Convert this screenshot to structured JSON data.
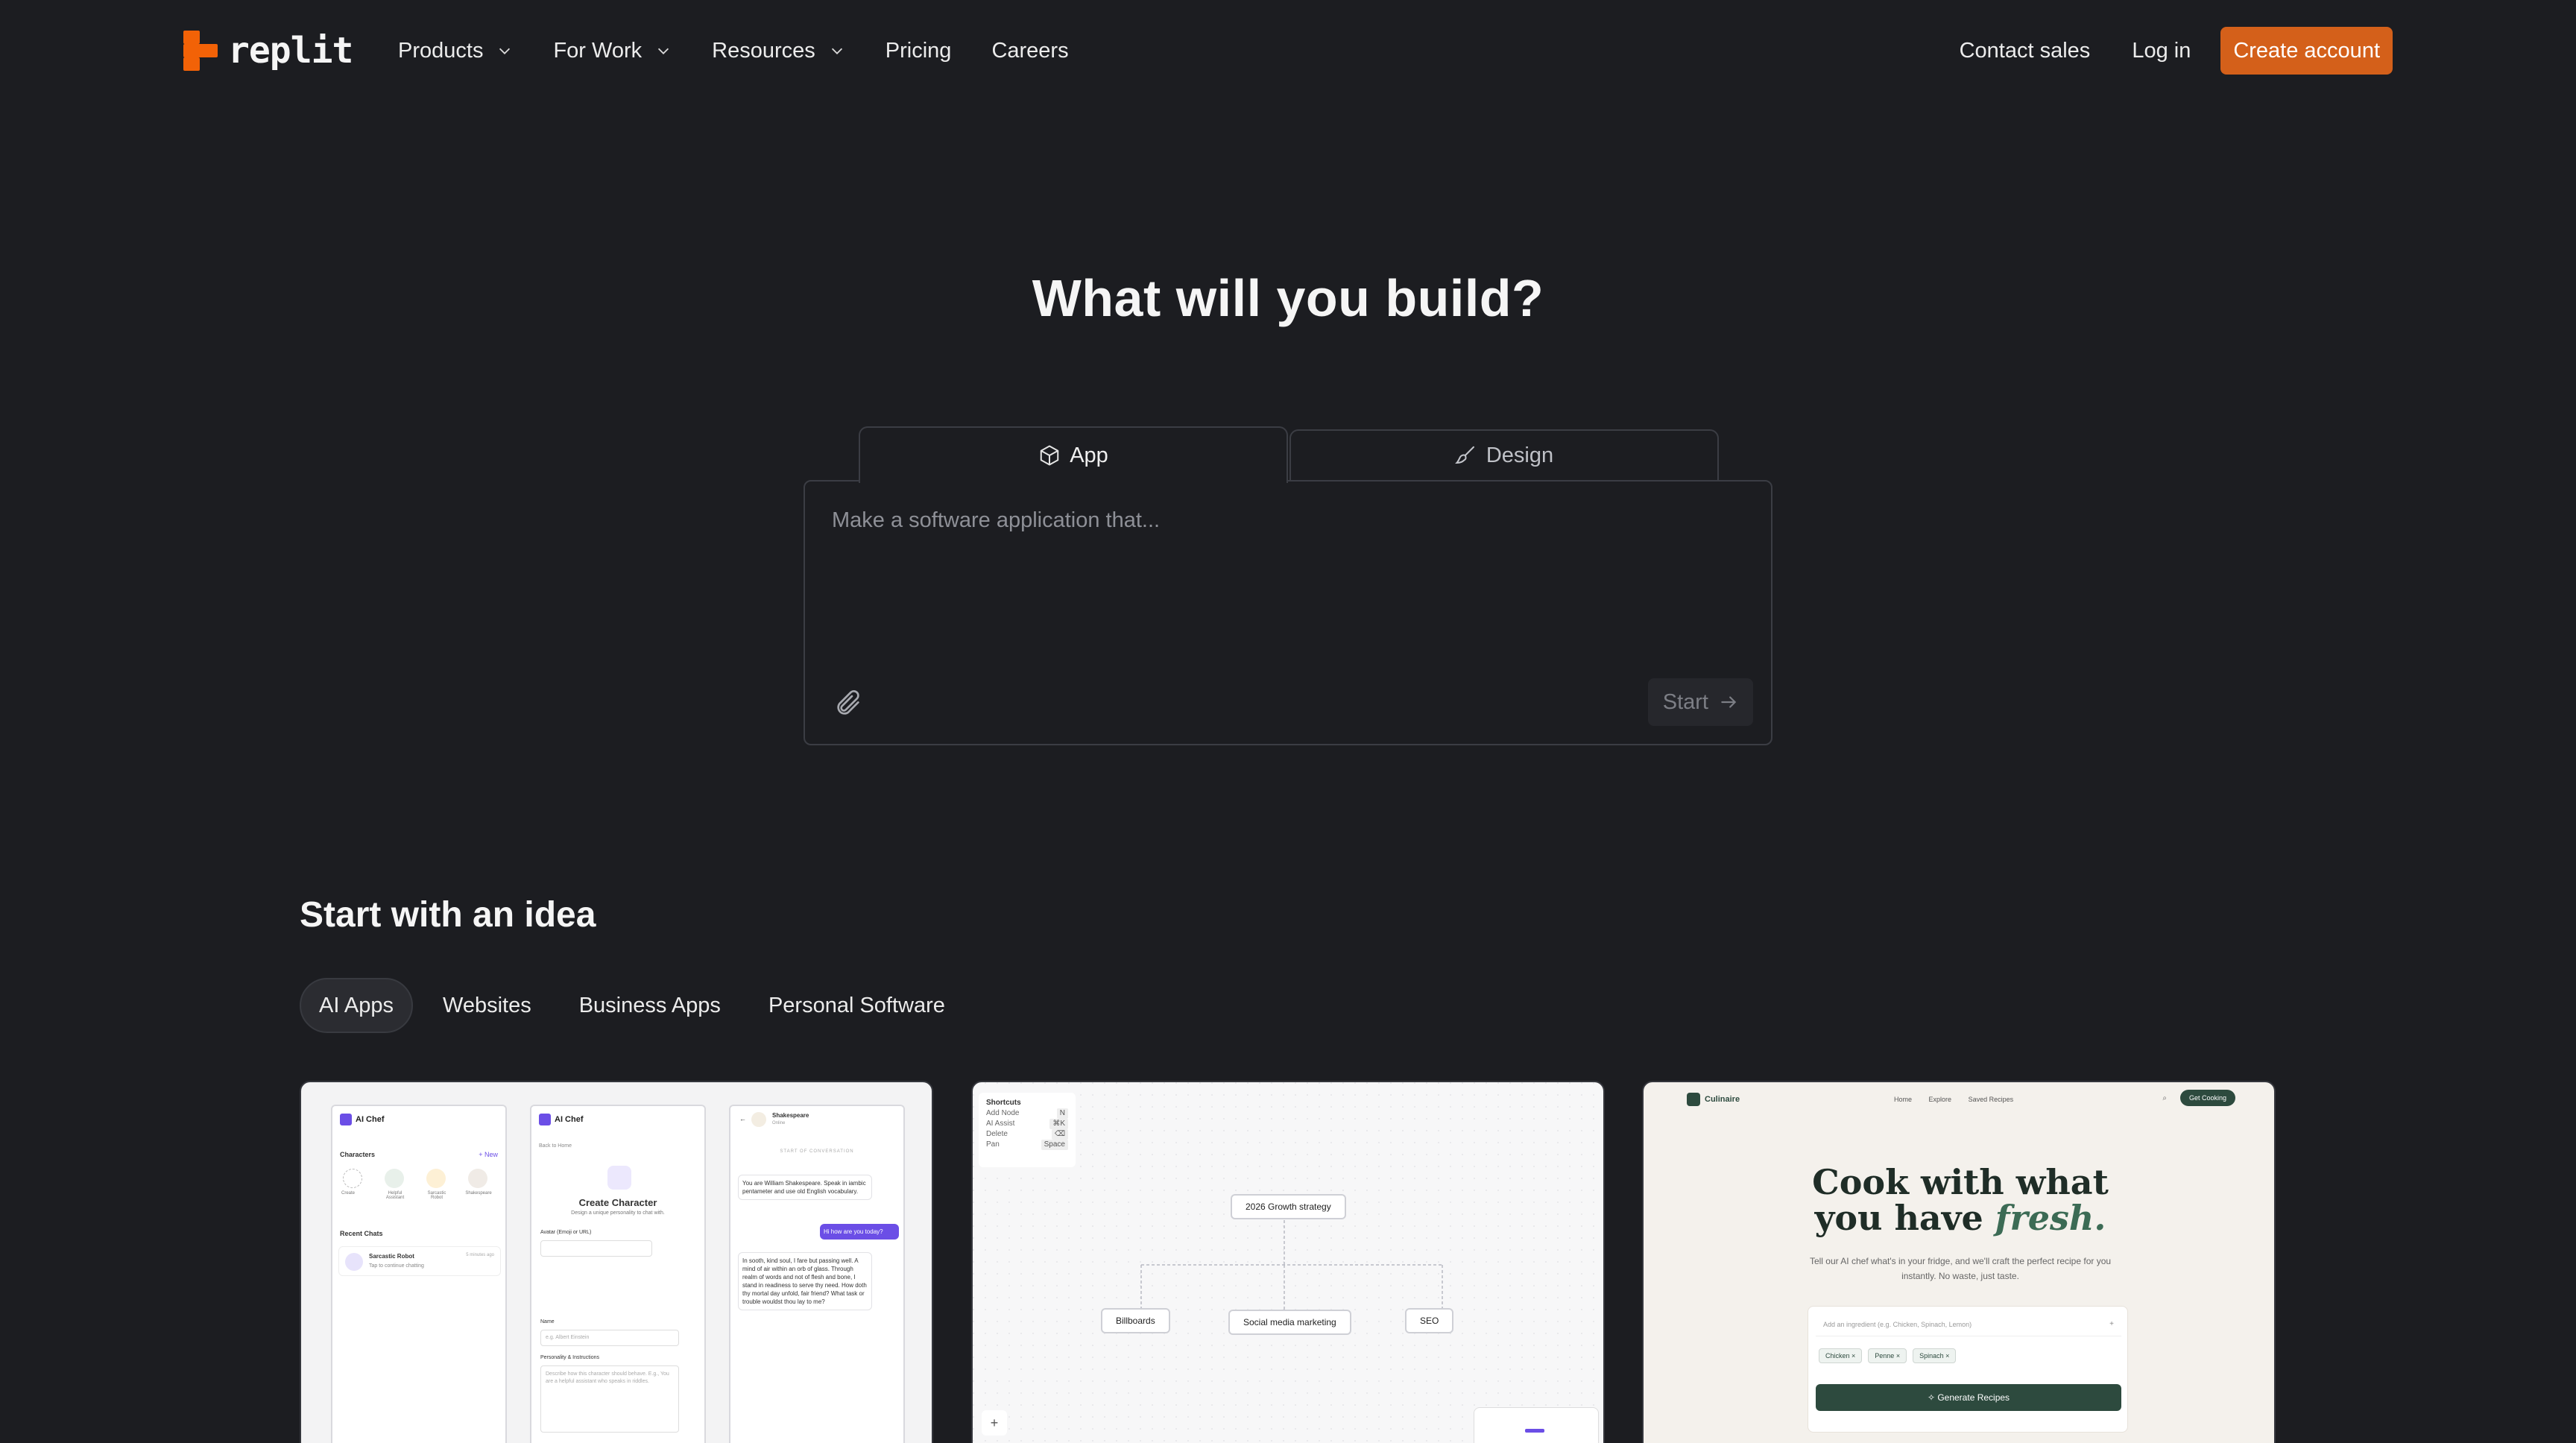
{
  "brand": {
    "name": "replit",
    "accent": "#f26207"
  },
  "nav": {
    "menu": [
      {
        "label": "Products",
        "has_dropdown": true
      },
      {
        "label": "For Work",
        "has_dropdown": true
      },
      {
        "label": "Resources",
        "has_dropdown": true
      },
      {
        "label": "Pricing",
        "has_dropdown": false
      },
      {
        "label": "Careers",
        "has_dropdown": false
      }
    ],
    "contact_sales": "Contact sales",
    "login": "Log in",
    "create_account": "Create account"
  },
  "hero": {
    "title": "What will you build?",
    "tabs": [
      {
        "label": "App",
        "icon": "cube-icon",
        "active": true
      },
      {
        "label": "Design",
        "icon": "brush-icon",
        "active": false
      }
    ],
    "prompt_placeholder": "Make a software application that...",
    "start_label": "Start"
  },
  "ideas": {
    "title": "Start with an idea",
    "filters": [
      {
        "label": "AI Apps",
        "active": true
      },
      {
        "label": "Websites",
        "active": false
      },
      {
        "label": "Business Apps",
        "active": false
      },
      {
        "label": "Personal Software",
        "active": false
      }
    ]
  },
  "cards": {
    "ai_chef": {
      "app_name": "AI Chef",
      "characters_label": "Characters",
      "new_label": "+ New",
      "create_label": "Create",
      "character_names": [
        "Helpful Assistant",
        "Sarcastic Robot",
        "Shakespeare"
      ],
      "recent_chats_label": "Recent Chats",
      "recent_chat_name": "Sarcastic Robot",
      "recent_chat_preview": "Tap to continue chatting",
      "recent_chat_time": "5 minutes ago",
      "back_label": "Back to Home",
      "create_title": "Create Character",
      "create_subtitle": "Design a unique personality to chat with.",
      "avatar_label": "Avatar (Emoji or URL)",
      "name_label": "Name",
      "name_placeholder": "e.g. Albert Einstein",
      "personality_label": "Personality & Instructions",
      "personality_placeholder": "Describe how this character should behave. E.g., You are a helpful assistant who speaks in riddles.",
      "chat_name": "Shakespeare",
      "chat_status": "Online",
      "chat_start": "START OF CONVERSATION",
      "msg_1": "You are William Shakespeare. Speak in iambic pentameter and use old English vocabulary.",
      "msg_2": "Hi how are you today?",
      "msg_3": "In sooth, kind soul, I fare but passing well. A mind of air within an orb of glass. Through realm of words and not of flesh and bone, I stand in readiness to serve thy need. How doth thy mortal day unfold, fair friend? What task or trouble wouldst thou lay to me?"
    },
    "growth": {
      "shortcuts_title": "Shortcuts",
      "shortcuts": [
        {
          "label": "Add Node",
          "key": "N"
        },
        {
          "label": "AI Assist",
          "key": "⌘K"
        },
        {
          "label": "Delete",
          "key": "⌫"
        },
        {
          "label": "Pan",
          "key": "Space"
        }
      ],
      "root": "2026 Growth strategy",
      "children": [
        "Billboards",
        "Social media marketing",
        "SEO"
      ],
      "add_symbol": "+"
    },
    "recipe": {
      "brand": "Culinaire",
      "links": [
        "Home",
        "Explore",
        "Saved Recipes"
      ],
      "cta": "Get Cooking",
      "headline_1": "Cook with what",
      "headline_2": "you have",
      "headline_em": "fresh.",
      "subtitle": "Tell our AI chef what's in your fridge, and we'll craft the perfect recipe for you instantly. No waste, just taste.",
      "input_placeholder": "Add an ingredient (e.g. Chicken, Spinach, Lemon)",
      "tags": [
        "Chicken",
        "Penne",
        "Spinach"
      ],
      "generate_label": "Generate Recipes"
    }
  }
}
